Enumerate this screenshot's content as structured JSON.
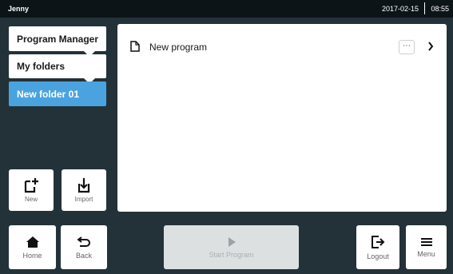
{
  "status_bar": {
    "user": "Jenny",
    "date": "2017-02-15",
    "time": "08:55"
  },
  "breadcrumb": [
    {
      "label": "Program Manager"
    },
    {
      "label": "My folders"
    },
    {
      "label": "New folder 01"
    }
  ],
  "side_actions": {
    "new_label": "New",
    "import_label": "Import"
  },
  "programs": [
    {
      "name": "New program",
      "more_label": "⋯"
    }
  ],
  "bottom_bar": {
    "home_label": "Home",
    "back_label": "Back",
    "start_label": "Start Program",
    "logout_label": "Logout",
    "menu_label": "Menu"
  },
  "colors": {
    "accent": "#4aa3df",
    "background": "#233238",
    "topbar": "#0c1418"
  }
}
